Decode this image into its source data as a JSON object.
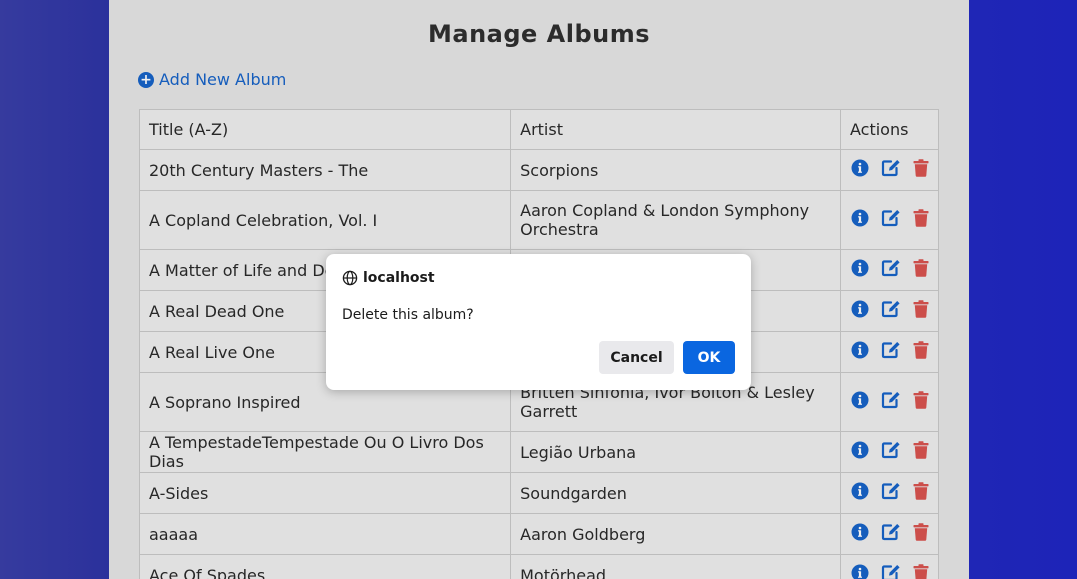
{
  "page": {
    "title": "Manage Albums",
    "add_link": "Add New Album"
  },
  "table": {
    "headers": [
      "Title (A-Z)",
      "Artist",
      "Actions"
    ],
    "rows": [
      {
        "title": "20th Century Masters - The",
        "artist": "Scorpions"
      },
      {
        "title": "A Copland Celebration, Vol. I",
        "artist": "Aaron Copland & London Symphony Orchestra"
      },
      {
        "title": "A Matter of Life and Deat",
        "artist": ""
      },
      {
        "title": "A Real Dead One",
        "artist": ""
      },
      {
        "title": "A Real Live One",
        "artist": ""
      },
      {
        "title": "A Soprano Inspired",
        "artist": "Britten Sinfonia, Ivor Bolton & Lesley Garrett"
      },
      {
        "title": "A TempestadeTempestade Ou O Livro Dos Dias",
        "artist": "Legião Urbana"
      },
      {
        "title": "A-Sides",
        "artist": "Soundgarden"
      },
      {
        "title": "aaaaa",
        "artist": "Aaron Goldberg"
      },
      {
        "title": "Ace Of Spades",
        "artist": "Motörhead"
      }
    ],
    "action_icons": [
      "info-icon",
      "edit-icon",
      "trash-icon"
    ]
  },
  "dialog": {
    "origin": "localhost",
    "message": "Delete this album?",
    "cancel_label": "Cancel",
    "ok_label": "OK"
  },
  "colors": {
    "link_blue": "#1763c8",
    "delete_red": "#d9534f",
    "ok_button": "#0a66e0"
  }
}
